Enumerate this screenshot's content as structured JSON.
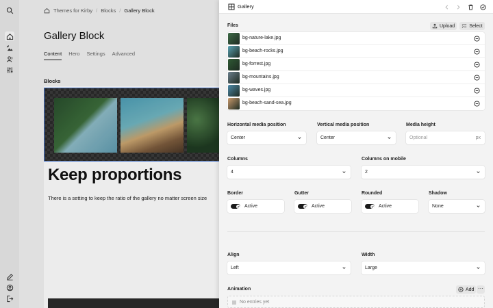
{
  "breadcrumb": {
    "items": [
      "Themes for Kirby",
      "Blocks",
      "Gallery Block"
    ]
  },
  "page": {
    "title": "Gallery Block",
    "tabs": [
      {
        "label": "Content",
        "active": true
      },
      {
        "label": "Hero",
        "active": false
      },
      {
        "label": "Settings",
        "active": false
      },
      {
        "label": "Advanced",
        "active": false
      }
    ],
    "blocks_label": "Blocks",
    "block_heading": "Keep proportions",
    "block_text": "There is a setting to keep the ratio of the gallery no matter screen size"
  },
  "sidebar": {
    "top_icons": [
      "search-icon",
      "home-icon",
      "image-magic-icon",
      "users-icon",
      "sliders-icon"
    ],
    "bottom_icons": [
      "edit-icon",
      "account-icon",
      "logout-icon"
    ]
  },
  "drawer": {
    "title": "Gallery",
    "files": {
      "label": "Files",
      "upload_label": "Upload",
      "select_label": "Select",
      "items": [
        {
          "name": "bg-nature-lake.jpg",
          "color": "#3e6b47"
        },
        {
          "name": "bg-beach-rocks.jpg",
          "color": "#5aa3b4"
        },
        {
          "name": "bg-forrest.jpg",
          "color": "#2f5a34"
        },
        {
          "name": "bg-mountains.jpg",
          "color": "#6b7f8c"
        },
        {
          "name": "bg-waves.jpg",
          "color": "#4c89a8"
        },
        {
          "name": "bg-beach-sand-sea.jpg",
          "color": "#c99a6d"
        }
      ]
    },
    "horizontal_position": {
      "label": "Horizontal media position",
      "value": "Center"
    },
    "vertical_position": {
      "label": "Vertical media position",
      "value": "Center"
    },
    "media_height": {
      "label": "Media height",
      "placeholder": "Optional",
      "unit": "px"
    },
    "columns": {
      "label": "Columns",
      "value": "4"
    },
    "columns_mobile": {
      "label": "Columns on mobile",
      "value": "2"
    },
    "border": {
      "label": "Border",
      "value": "Active"
    },
    "gutter": {
      "label": "Gutter",
      "value": "Active"
    },
    "rounded": {
      "label": "Rounded",
      "value": "Active"
    },
    "shadow": {
      "label": "Shadow",
      "value": "None"
    },
    "align": {
      "label": "Align",
      "value": "Left"
    },
    "width": {
      "label": "Width",
      "value": "Large"
    },
    "animation": {
      "label": "Animation",
      "add_label": "Add",
      "more_label": "···",
      "empty_text": "No entries yet"
    }
  }
}
